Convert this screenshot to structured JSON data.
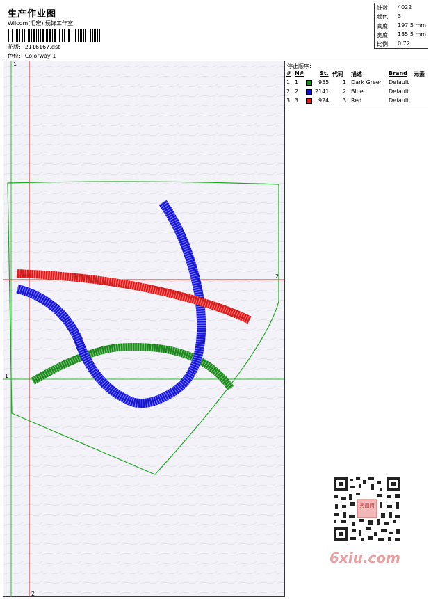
{
  "header": {
    "title": "生产作业图",
    "company": "Wilcom(汇宏) 绣饰工作室",
    "design_label": "花版:",
    "design_value": "2116167.dst",
    "colorway_label": "色位:",
    "colorway_value": "Colorway 1"
  },
  "stats": [
    {
      "label": "针数:",
      "value": "4022"
    },
    {
      "label": "颜色:",
      "value": "3"
    },
    {
      "label": "高度:",
      "value": "197.5 mm"
    },
    {
      "label": "宽度:",
      "value": "185.5 mm"
    },
    {
      "label": "比例:",
      "value": "0.72"
    }
  ],
  "stop_sequence": {
    "title": "停止顺序:",
    "headers": {
      "index": "#",
      "needle": "N#",
      "st": "St.",
      "code": "代码",
      "desc": "描述",
      "brand": "Brand",
      "element": "元素"
    },
    "rows": [
      {
        "index": "1.",
        "needle": "1",
        "color": "#1a8a1a",
        "st": "955",
        "code": "1",
        "desc": "Dark Green",
        "brand": "Default"
      },
      {
        "index": "2.",
        "needle": "2",
        "color": "#1010d8",
        "st": "2141",
        "code": "2",
        "desc": "Blue",
        "brand": "Default"
      },
      {
        "index": "3.",
        "needle": "3",
        "color": "#e01818",
        "st": "924",
        "code": "3",
        "desc": "Red",
        "brand": "Default"
      }
    ]
  },
  "guides": {
    "green_vertical": "1",
    "green_horizontal": "1",
    "red_vertical": "2",
    "red_horizontal": "2"
  },
  "colors": {
    "outline": "#21a821",
    "green_guide": "#2fbf2f",
    "red_guide": "#e02020",
    "thread_green": "#1a8a1a",
    "thread_blue": "#1515e0",
    "thread_red": "#e01818"
  },
  "watermark": {
    "brand": "6xiu.com",
    "stamp": "秀图网"
  }
}
